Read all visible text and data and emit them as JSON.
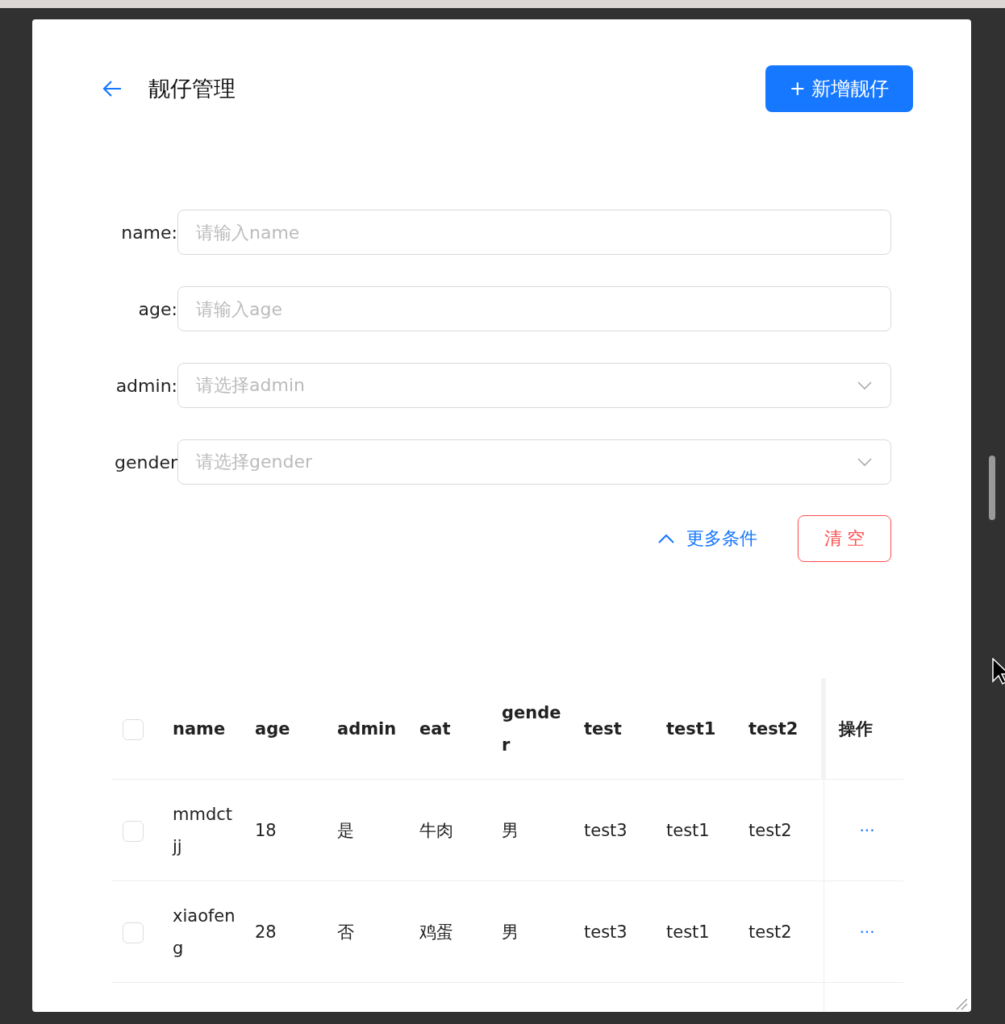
{
  "header": {
    "title": "靓仔管理",
    "add_button": "+ 新增靓仔"
  },
  "filters": [
    {
      "kind": "input",
      "label": "name:",
      "placeholder": "请输入name"
    },
    {
      "kind": "input",
      "label": "age:",
      "placeholder": "请输入age"
    },
    {
      "kind": "select",
      "label": "admin:",
      "placeholder": "请选择admin"
    },
    {
      "kind": "select",
      "label": "gender",
      "placeholder": "请选择gender"
    }
  ],
  "more_conditions": {
    "label": "更多条件",
    "expanded": true
  },
  "clear_button": "清 空",
  "table": {
    "all_checked": false,
    "columns": [
      "name",
      "age",
      "admin",
      "eat",
      "gender",
      "test",
      "test1",
      "test2",
      "操作"
    ],
    "rows": [
      {
        "checked": false,
        "cells": [
          "mmdctjj",
          "18",
          "是",
          "牛肉",
          "男",
          "test3",
          "test1",
          "test2"
        ],
        "action": "···"
      },
      {
        "checked": false,
        "cells": [
          "xiaofeng",
          "28",
          "否",
          "鸡蛋",
          "男",
          "test3",
          "test1",
          "test2"
        ],
        "action": "···"
      }
    ]
  }
}
